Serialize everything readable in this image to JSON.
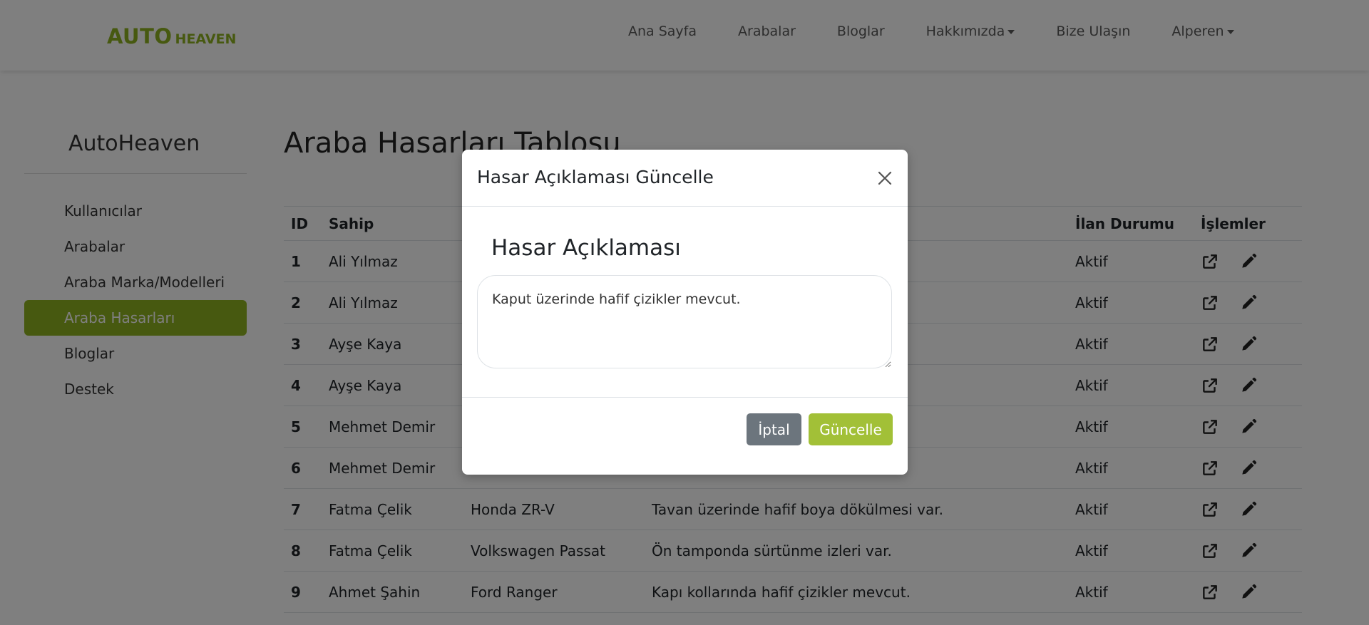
{
  "brand": {
    "part1": "AUTO",
    "part2": "HEAVEN"
  },
  "nav": {
    "home": "Ana Sayfa",
    "cars": "Arabalar",
    "blogs": "Bloglar",
    "about": "Hakkımızda",
    "contact": "Bize Ulaşın",
    "user": "Alperen"
  },
  "sidebar": {
    "title": "AutoHeaven",
    "items": [
      {
        "label": "Kullanıcılar"
      },
      {
        "label": "Arabalar"
      },
      {
        "label": "Araba Marka/Modelleri"
      },
      {
        "label": "Araba Hasarları"
      },
      {
        "label": "Bloglar"
      },
      {
        "label": "Destek"
      }
    ]
  },
  "page": {
    "title": "Araba Hasarları Tablosu"
  },
  "table": {
    "headers": {
      "id": "ID",
      "owner": "Sahip",
      "car": "",
      "description": "",
      "status": "İlan Durumu",
      "actions": "İşlemler"
    },
    "rows": [
      {
        "id": "1",
        "owner": "Ali Yılmaz",
        "car": "",
        "description": "",
        "status": "Aktif"
      },
      {
        "id": "2",
        "owner": "Ali Yılmaz",
        "car": "",
        "description": "",
        "status": "Aktif"
      },
      {
        "id": "3",
        "owner": "Ayşe Kaya",
        "car": "",
        "description": "",
        "status": "Aktif"
      },
      {
        "id": "4",
        "owner": "Ayşe Kaya",
        "car": "",
        "description": "",
        "status": "Aktif"
      },
      {
        "id": "5",
        "owner": "Mehmet Demir",
        "car": "",
        "description": "",
        "status": "Aktif"
      },
      {
        "id": "6",
        "owner": "Mehmet Demir",
        "car": "",
        "description": "",
        "status": "Aktif"
      },
      {
        "id": "7",
        "owner": "Fatma Çelik",
        "car": "Honda ZR-V",
        "description": "Tavan üzerinde hafif boya dökülmesi var.",
        "status": "Aktif"
      },
      {
        "id": "8",
        "owner": "Fatma Çelik",
        "car": "Volkswagen Passat",
        "description": "Ön tamponda sürtünme izleri var.",
        "status": "Aktif"
      },
      {
        "id": "9",
        "owner": "Ahmet Şahin",
        "car": "Ford Ranger",
        "description": "Kapı kollarında hafif çizikler mevcut.",
        "status": "Aktif"
      }
    ]
  },
  "modal": {
    "title": "Hasar Açıklaması Güncelle",
    "field_label": "Hasar Açıklaması",
    "description_value": "Kaput üzerinde hafif çizikler mevcut.",
    "cancel_label": "İptal",
    "update_label": "Güncelle"
  },
  "colors": {
    "brand": "#8fb320",
    "update_button": "#a2c037",
    "cancel_button": "#6c757d"
  },
  "icons": {
    "row_open": "external-link-icon",
    "row_edit": "pencil-icon",
    "close": "close-icon"
  }
}
